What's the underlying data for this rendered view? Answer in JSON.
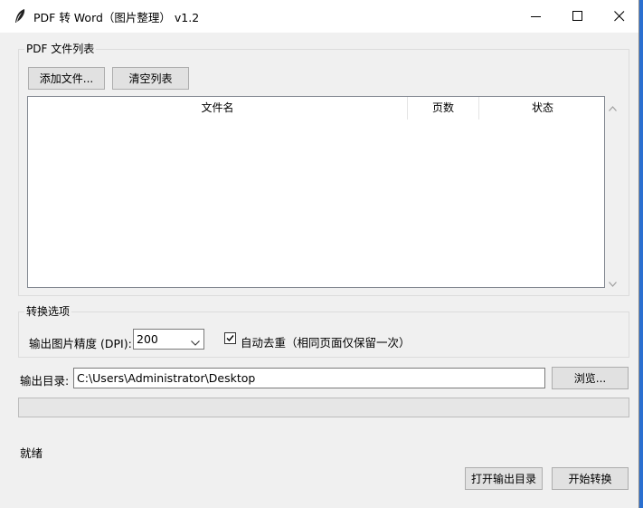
{
  "window": {
    "title": "PDF 转 Word（图片整理） v1.2"
  },
  "file_group": {
    "legend": "PDF 文件列表",
    "add_button": "添加文件...",
    "clear_button": "清空列表",
    "columns": [
      "文件名",
      "页数",
      "状态"
    ],
    "rows": []
  },
  "options_group": {
    "legend": "转换选项",
    "dpi_label": "输出图片精度 (DPI):",
    "dpi_value": "200",
    "dedup_checked": true,
    "dedup_label": "自动去重（相同页面仅保留一次）"
  },
  "output": {
    "label": "输出目录:",
    "path": "C:\\Users\\Administrator\\Desktop",
    "browse_button": "浏览..."
  },
  "progress": {
    "fraction": 0
  },
  "status_text": "就绪",
  "footer": {
    "open_dir_button": "打开输出目录",
    "start_button": "开始转换"
  },
  "colors": {
    "accent_desktop": "#2a6fd0",
    "progress_fill": "#06b025"
  }
}
